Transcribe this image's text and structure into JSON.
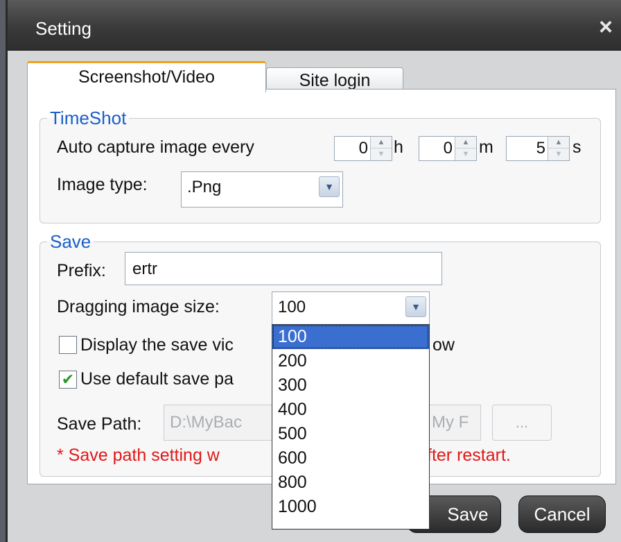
{
  "dialog": {
    "title": "Setting"
  },
  "tabs": [
    {
      "label": "Screenshot/Video"
    },
    {
      "label": "Site login"
    }
  ],
  "timeshot": {
    "legend": "TimeShot",
    "auto_capture_label": "Auto capture image every",
    "hours": {
      "value": "0",
      "unit": "h"
    },
    "minutes": {
      "value": "0",
      "unit": "m"
    },
    "seconds": {
      "value": "5",
      "unit": "s"
    },
    "image_type_label": "Image type:",
    "image_type_value": ".Png"
  },
  "save": {
    "legend": "Save",
    "prefix_label": "Prefix:",
    "prefix_value": "ertr",
    "dragging_label": "Dragging image size:",
    "dragging_value": "100",
    "dragging_options": [
      "100",
      "200",
      "300",
      "400",
      "500",
      "600",
      "800",
      "1000"
    ],
    "display_save_label": "Display the save vic",
    "display_save_tail": "ow",
    "use_default_label": "Use default save pa",
    "save_path_label": "Save Path:",
    "save_path_left": "D:\\MyBac",
    "save_path_right": "My F",
    "browse_label": "...",
    "note_left": "* Save path setting w",
    "note_right": "fter restart."
  },
  "buttons": {
    "save": "Save",
    "cancel": "Cancel"
  },
  "icons": {
    "close": "close-icon",
    "spin_up": "arrow-up-icon",
    "spin_down": "arrow-down-icon",
    "dropdown": "chevron-down-icon",
    "check": "checkmark-icon"
  },
  "colors": {
    "legend": "#1a5fc8",
    "note": "#e01818",
    "tab_accent": "#f0a020",
    "selected_option": "#3a6fd0"
  }
}
